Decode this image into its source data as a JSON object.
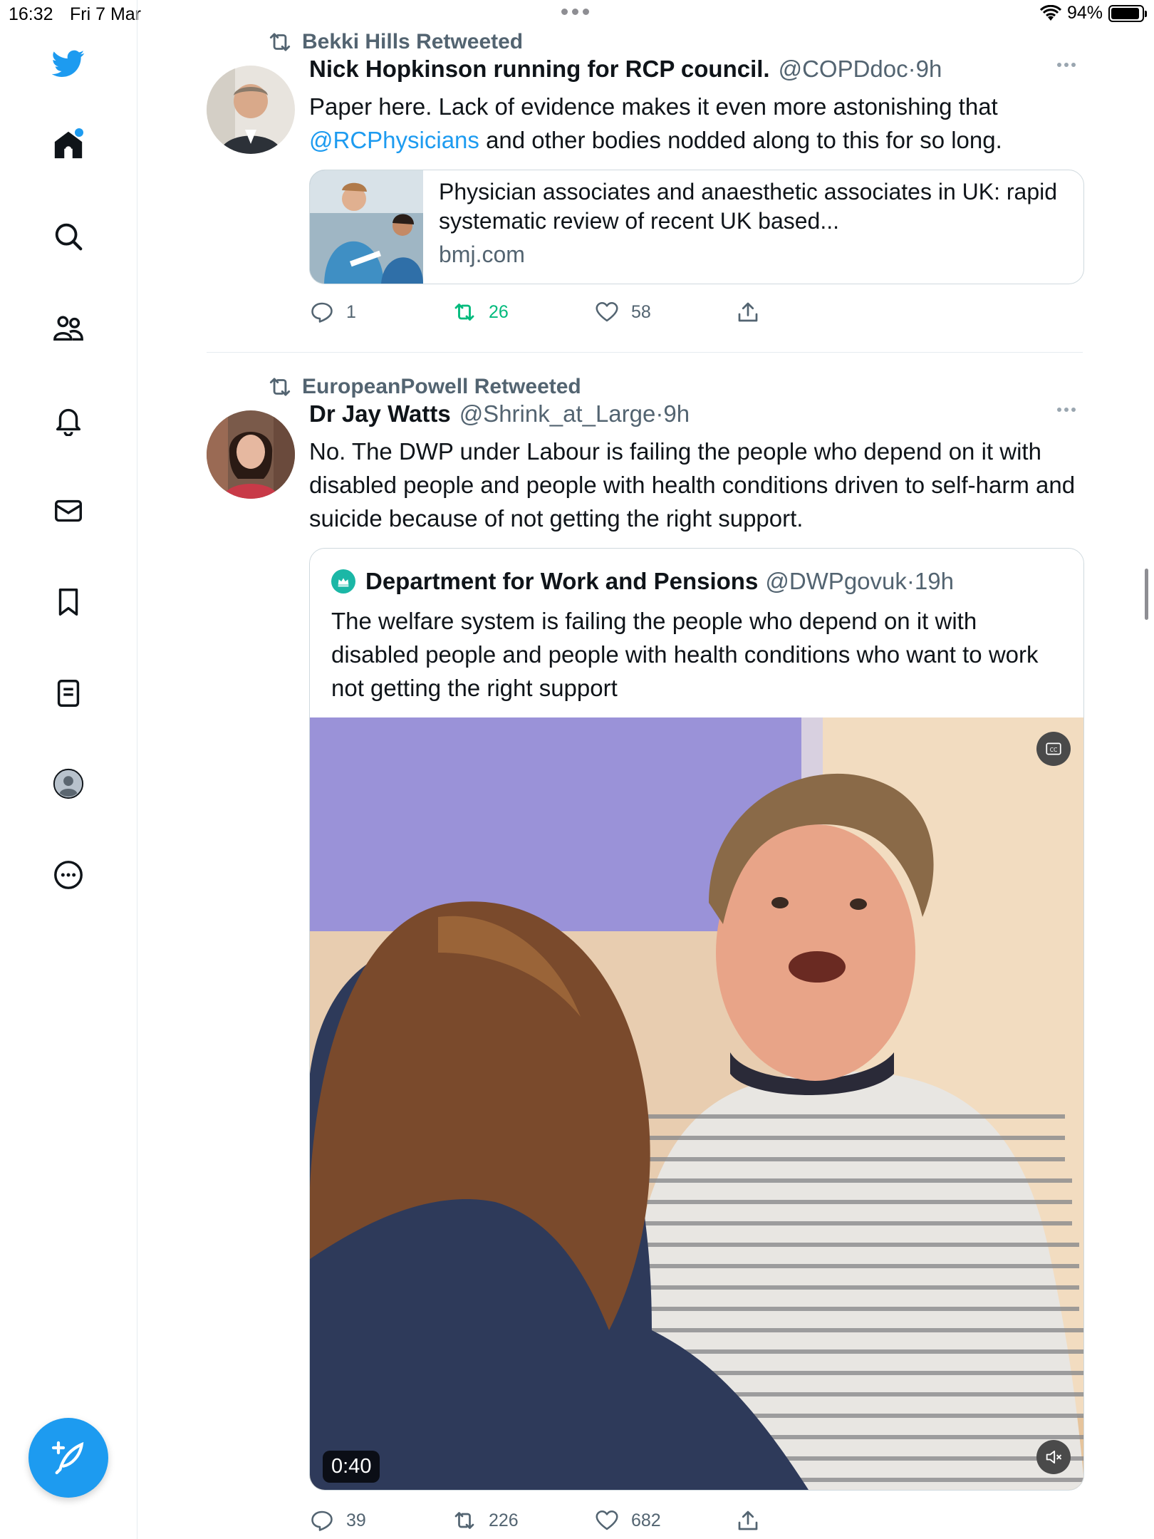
{
  "status_bar": {
    "time": "16:32",
    "date": "Fri 7 Mar",
    "battery": "94%"
  },
  "sidebar": {
    "items": [
      "twitter-logo",
      "home",
      "search",
      "communities",
      "notifications",
      "messages",
      "bookmarks",
      "lists",
      "profile",
      "more"
    ],
    "accent_color": "#1d9bf0"
  },
  "tweets": [
    {
      "retweeted_by": "Bekki Hills Retweeted",
      "name": "Nick Hopkinson running for RCP council.",
      "handle": "@COPDdoc",
      "sep": "·",
      "time": "9h",
      "text_before": "Paper here. Lack of evidence makes it even more astonishing that",
      "mention": "@RCPhysicians",
      "text_after": " and other bodies nodded along to this for so long.",
      "link_card": {
        "title": "Physician associates and anaesthetic associates in UK: rapid systematic review of recent UK based...",
        "domain": "bmj.com"
      },
      "replies": "1",
      "retweets": "26",
      "likes": "58"
    },
    {
      "retweeted_by": "EuropeanPowell Retweeted",
      "name": "Dr Jay Watts",
      "handle": "@Shrink_at_Large",
      "sep": "·",
      "time": "9h",
      "text": "No. The DWP under Labour is failing the people who depend on it with disabled people and people with health conditions driven to self-harm and suicide because of not getting the right support.",
      "quote": {
        "name": "Department for Work and Pensions",
        "handle": "@DWPgovuk",
        "sep": "·",
        "time": "19h",
        "text": "The welfare system is failing the people who depend on it with disabled people and people with health conditions who want to work not getting the right support",
        "video_duration": "0:40"
      },
      "replies": "39",
      "retweets": "226",
      "likes": "682"
    }
  ]
}
